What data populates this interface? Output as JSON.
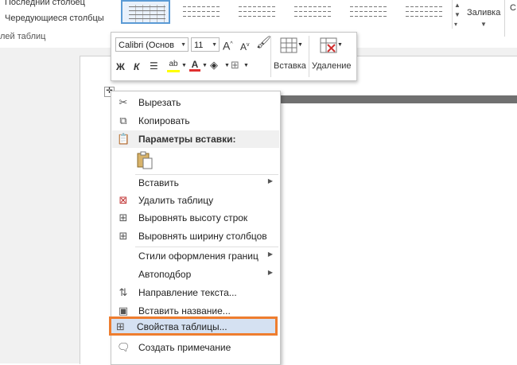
{
  "ribbon": {
    "options": [
      "Последний столбец",
      "Чередующиеся столбцы"
    ],
    "group_label": "лей таблиц",
    "fill_label": "Заливка",
    "edge_label": "С"
  },
  "mini_toolbar": {
    "font": "Calibri (Основ",
    "size": "11",
    "grow_font": "A",
    "shrink_font": "A",
    "bold": "Ж",
    "italic": "К",
    "font_color_letter": "A",
    "insert_label": "Вставка",
    "delete_label": "Удаление"
  },
  "context_menu": {
    "items": [
      {
        "label": "Вырезать",
        "icon": "scissors-icon"
      },
      {
        "label": "Копировать",
        "icon": "copy-icon"
      },
      {
        "label": "Параметры вставки:",
        "icon": "paste-icon"
      },
      {
        "label": "Вставить",
        "icon": "none"
      },
      {
        "label": "Удалить таблицу",
        "icon": "delete-table-icon"
      },
      {
        "label": "Выровнять высоту строк",
        "icon": "distribute-rows-icon"
      },
      {
        "label": "Выровнять ширину столбцов",
        "icon": "distribute-columns-icon"
      },
      {
        "label": "Стили оформления границ",
        "icon": "none"
      },
      {
        "label": "Автоподбор",
        "icon": "none"
      },
      {
        "label": "Направление текста...",
        "icon": "text-direction-icon"
      },
      {
        "label": "Вставить название...",
        "icon": "caption-icon"
      },
      {
        "label": "Свойства таблицы...",
        "icon": "table-properties-icon"
      },
      {
        "label": "Создать примечание",
        "icon": "comment-icon"
      }
    ]
  },
  "colors": {
    "highlight_border": "#ee7d2f",
    "highlight_fill": "#d5e1f2",
    "font_color_bar": "#e03030",
    "highlighter_bar": "#ffff00",
    "accent_blue": "#5b9bd5"
  }
}
